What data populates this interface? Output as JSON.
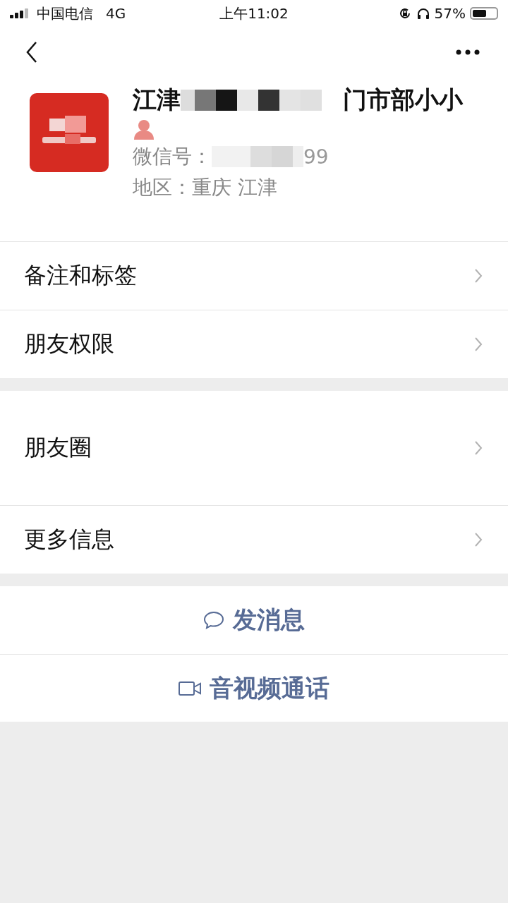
{
  "status_bar": {
    "carrier": "中国电信",
    "network": "4G",
    "time": "上午11:02",
    "battery": "57%"
  },
  "profile": {
    "name_start": "江津",
    "name_end": "门市部小小",
    "wechat_id_label": "微信号：",
    "wechat_id_end": "99",
    "region": "地区：重庆 江津"
  },
  "groups": [
    [
      {
        "label": "备注和标签",
        "tall": false
      },
      {
        "label": "朋友权限",
        "tall": false
      }
    ],
    [
      {
        "label": "朋友圈",
        "tall": true
      },
      {
        "label": "更多信息",
        "tall": false
      }
    ]
  ],
  "actions": [
    {
      "kind": "message",
      "label": "发消息"
    },
    {
      "kind": "call",
      "label": "音视频通话"
    }
  ]
}
